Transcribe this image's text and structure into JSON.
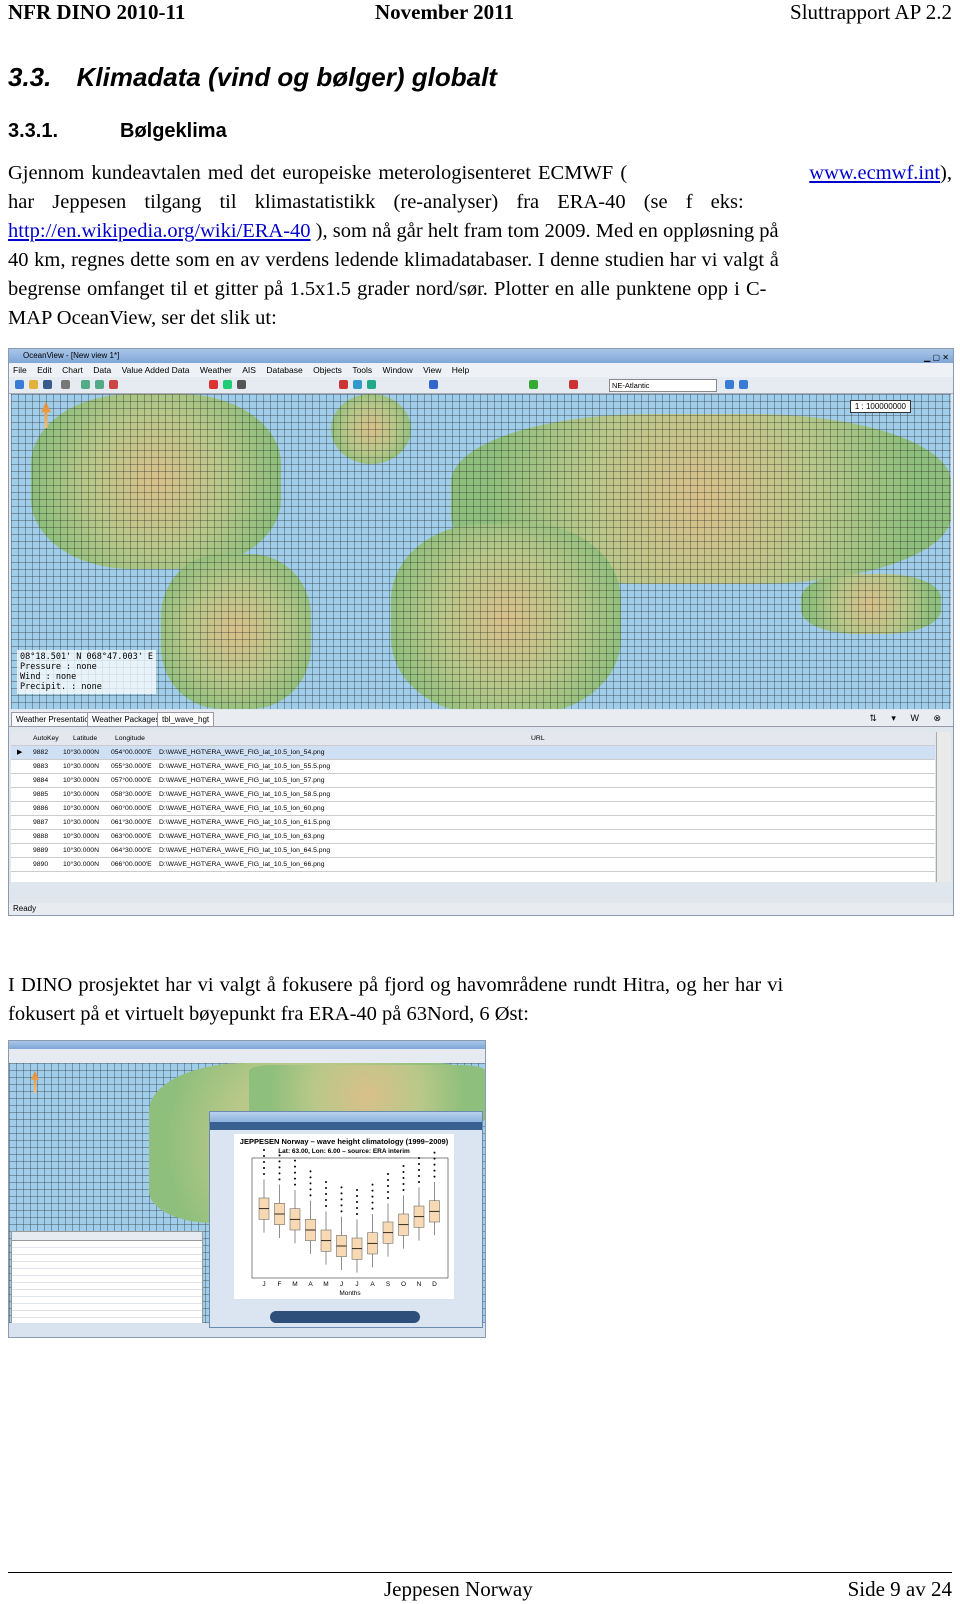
{
  "header": {
    "left": "NFR DINO 2010-11",
    "center": "November 2011",
    "right": "Sluttrapport AP 2.2"
  },
  "section": {
    "number": "3.3.",
    "title": "Klimadata (vind og bølger) globalt"
  },
  "subsection": {
    "number": "3.3.1.",
    "title": "Bølgeklima"
  },
  "paragraph1": {
    "l1_a": "Gjennom kundeavtalen med det europeiske meterologisenteret ECMWF (",
    "l1_link": "www.ecmwf.int",
    "l1_b": "),",
    "l2": "har Jeppesen tilgang til klimastatistikk (re-analyser) fra ERA-40 (se f eks:",
    "l3_link": "http://en.wikipedia.org/wiki/ERA-40",
    "l3_b": " ), som nå går helt fram tom 2009. Med en oppløsning på",
    "l4": "40 km, regnes dette som en av verdens ledende klimadatabaser. I denne studien har vi valgt å",
    "l5": "begrense omfanget til et gitter på 1.5x1.5 grader nord/sør. Plotter en alle punktene opp i C-",
    "l6": "MAP OceanView, ser det slik ut:"
  },
  "screenshot1": {
    "window_title": "OceanView - [New view 1*]",
    "menu": [
      "File",
      "Edit",
      "Chart",
      "Data",
      "Value Added Data",
      "Weather",
      "AIS",
      "Database",
      "Objects",
      "Tools",
      "Window",
      "View",
      "Help"
    ],
    "region_combo": "NE-Atlantic",
    "scale": "1 : 100000000",
    "coords": [
      "08°18.501' N 068°47.003' E",
      "Pressure  : none",
      "Wind      : none",
      "Precipit. : none"
    ],
    "tabs": [
      "Weather Presentation",
      "Weather Packages",
      "tbl_wave_hgt"
    ],
    "columns": [
      "AutoKey",
      "Latitude",
      "Longitude",
      "URL"
    ],
    "rows": [
      [
        "9882",
        "10°30.000N",
        "054°00.000'E",
        "D:\\WAVE_HGT\\ERA_WAVE_FIG_lat_10.5_lon_54.png"
      ],
      [
        "9883",
        "10°30.000N",
        "055°30.000'E",
        "D:\\WAVE_HGT\\ERA_WAVE_FIG_lat_10.5_lon_55.5.png"
      ],
      [
        "9884",
        "10°30.000N",
        "057°00.000'E",
        "D:\\WAVE_HGT\\ERA_WAVE_FIG_lat_10.5_lon_57.png"
      ],
      [
        "9885",
        "10°30.000N",
        "058°30.000'E",
        "D:\\WAVE_HGT\\ERA_WAVE_FIG_lat_10.5_lon_58.5.png"
      ],
      [
        "9886",
        "10°30.000N",
        "060°00.000'E",
        "D:\\WAVE_HGT\\ERA_WAVE_FIG_lat_10.5_lon_60.png"
      ],
      [
        "9887",
        "10°30.000N",
        "061°30.000'E",
        "D:\\WAVE_HGT\\ERA_WAVE_FIG_lat_10.5_lon_61.5.png"
      ],
      [
        "9888",
        "10°30.000N",
        "063°00.000'E",
        "D:\\WAVE_HGT\\ERA_WAVE_FIG_lat_10.5_lon_63.png"
      ],
      [
        "9889",
        "10°30.000N",
        "064°30.000'E",
        "D:\\WAVE_HGT\\ERA_WAVE_FIG_lat_10.5_lon_64.5.png"
      ],
      [
        "9890",
        "10°30.000N",
        "066°00.000'E",
        "D:\\WAVE_HGT\\ERA_WAVE_FIG_lat_10.5_lon_66.png"
      ]
    ],
    "status": "Ready"
  },
  "paragraph2": {
    "l1": "I DINO prosjektet har vi valgt å fokusere på fjord og havområdene rundt Hitra, og her har vi",
    "l2": "fokusert på et virtuelt bøyepunkt fra ERA-40 på 63Nord, 6 Øst:"
  },
  "screenshot2": {
    "viewer_title": "JEPPESEN Norway – wave height climatology (1999–2009)",
    "viewer_subtitle": "Lat: 63.00, Lon: 6.00 – source: ERA interim",
    "xlabel": "Months",
    "months": [
      "J",
      "F",
      "M",
      "A",
      "M",
      "J",
      "J",
      "A",
      "S",
      "O",
      "N",
      "D"
    ],
    "medians": [
      5.2,
      4.8,
      4.4,
      3.6,
      2.8,
      2.4,
      2.2,
      2.6,
      3.4,
      4.0,
      4.6,
      5.0
    ]
  },
  "footer": {
    "center": "Jeppesen Norway",
    "right": "Side 9 av 24"
  }
}
